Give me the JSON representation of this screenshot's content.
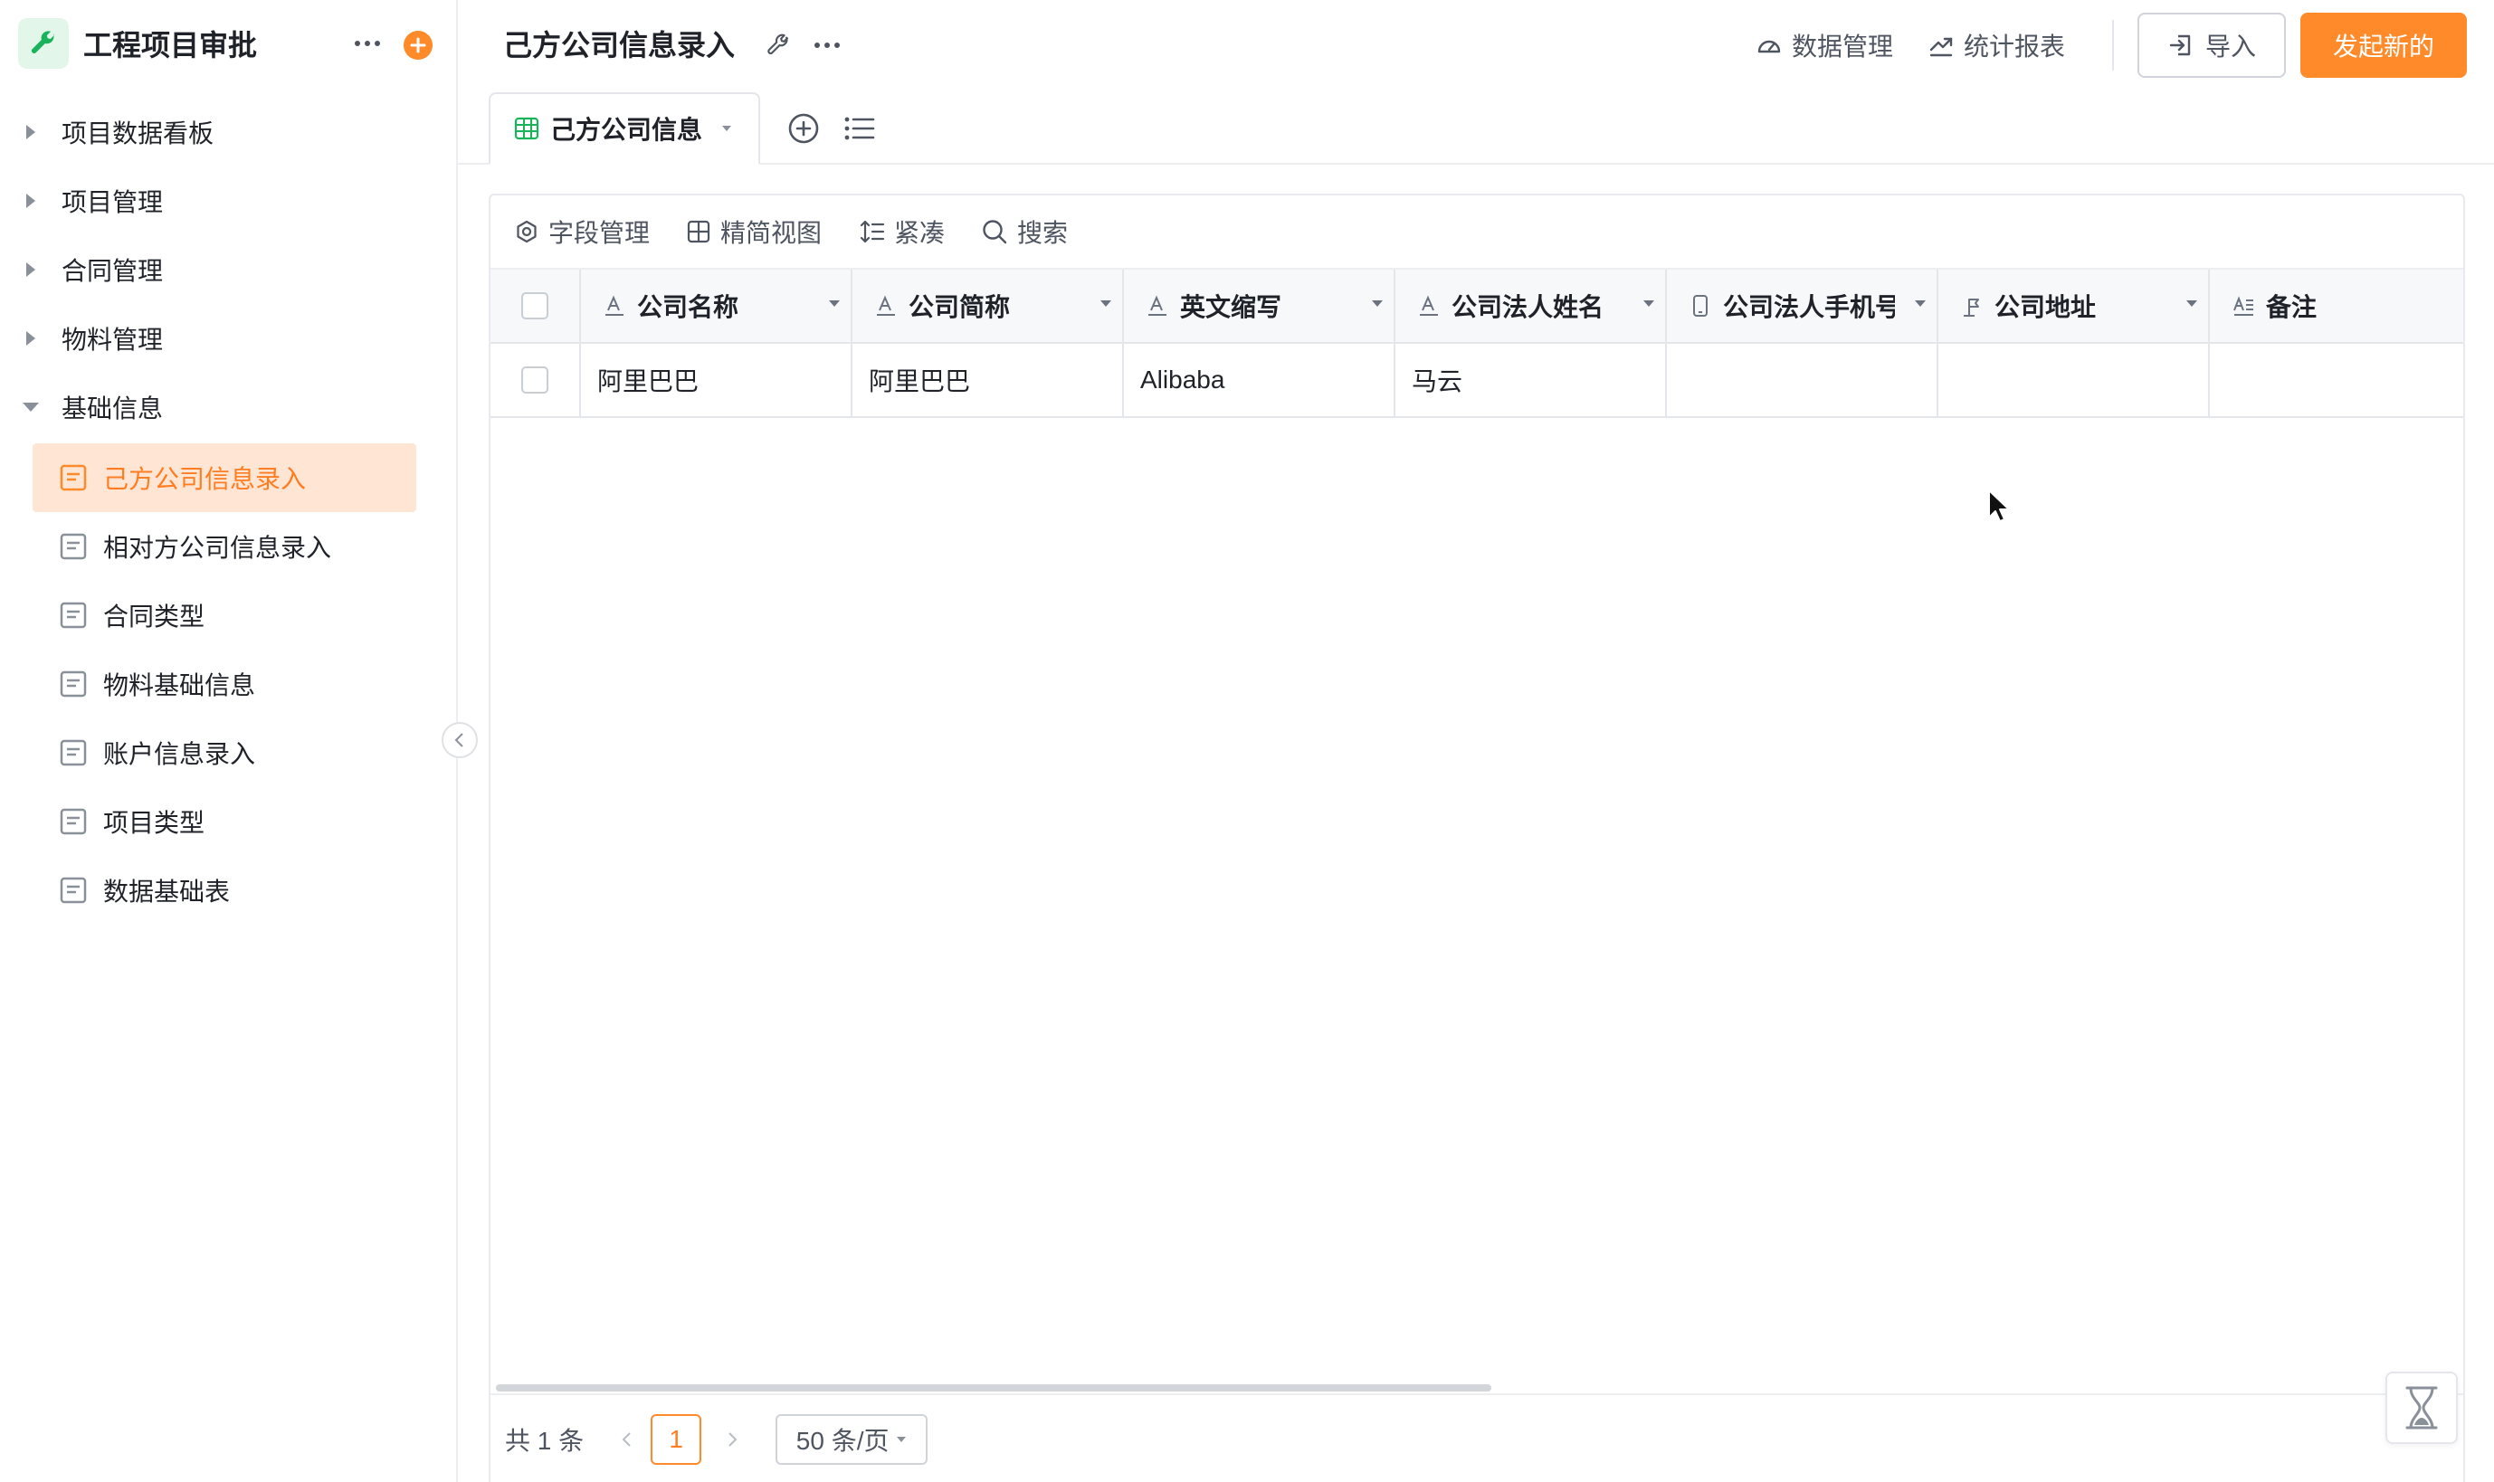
{
  "app": {
    "title": "工程项目审批",
    "accent_color": "#ff8a2a",
    "logo_icon": "wrench-icon"
  },
  "sidebar": {
    "groups": [
      {
        "label": "项目数据看板",
        "expanded": false
      },
      {
        "label": "项目管理",
        "expanded": false
      },
      {
        "label": "合同管理",
        "expanded": false
      },
      {
        "label": "物料管理",
        "expanded": false
      },
      {
        "label": "基础信息",
        "expanded": true
      }
    ],
    "items": [
      {
        "label": "己方公司信息录入",
        "active": true
      },
      {
        "label": "相对方公司信息录入",
        "active": false
      },
      {
        "label": "合同类型",
        "active": false
      },
      {
        "label": "物料基础信息",
        "active": false
      },
      {
        "label": "账户信息录入",
        "active": false
      },
      {
        "label": "项目类型",
        "active": false
      },
      {
        "label": "数据基础表",
        "active": false
      }
    ]
  },
  "header": {
    "title": "己方公司信息录入",
    "links": {
      "data_manage": "数据管理",
      "reports": "统计报表"
    },
    "import_label": "导入",
    "new_label": "发起新的"
  },
  "tabs": [
    {
      "label": "己方公司信息",
      "active": true
    }
  ],
  "toolbar": {
    "fields": "字段管理",
    "compact_view": "精简视图",
    "density": "紧凑",
    "search": "搜索"
  },
  "table": {
    "columns": [
      {
        "label": "公司名称",
        "icon": "text-field-icon"
      },
      {
        "label": "公司简称",
        "icon": "text-field-icon"
      },
      {
        "label": "英文缩写",
        "icon": "text-field-icon"
      },
      {
        "label": "公司法人姓名",
        "icon": "text-field-icon"
      },
      {
        "label": "公司法人手机号",
        "icon": "phone-field-icon"
      },
      {
        "label": "公司地址",
        "icon": "location-field-icon"
      },
      {
        "label": "备注",
        "icon": "multiline-text-field-icon"
      }
    ],
    "rows": [
      [
        "阿里巴巴",
        "阿里巴巴",
        "Alibaba",
        "马云",
        "",
        "",
        ""
      ]
    ]
  },
  "pagination": {
    "total_label": "共 1 条",
    "current_page": "1",
    "page_size_label": "50 条/页"
  }
}
